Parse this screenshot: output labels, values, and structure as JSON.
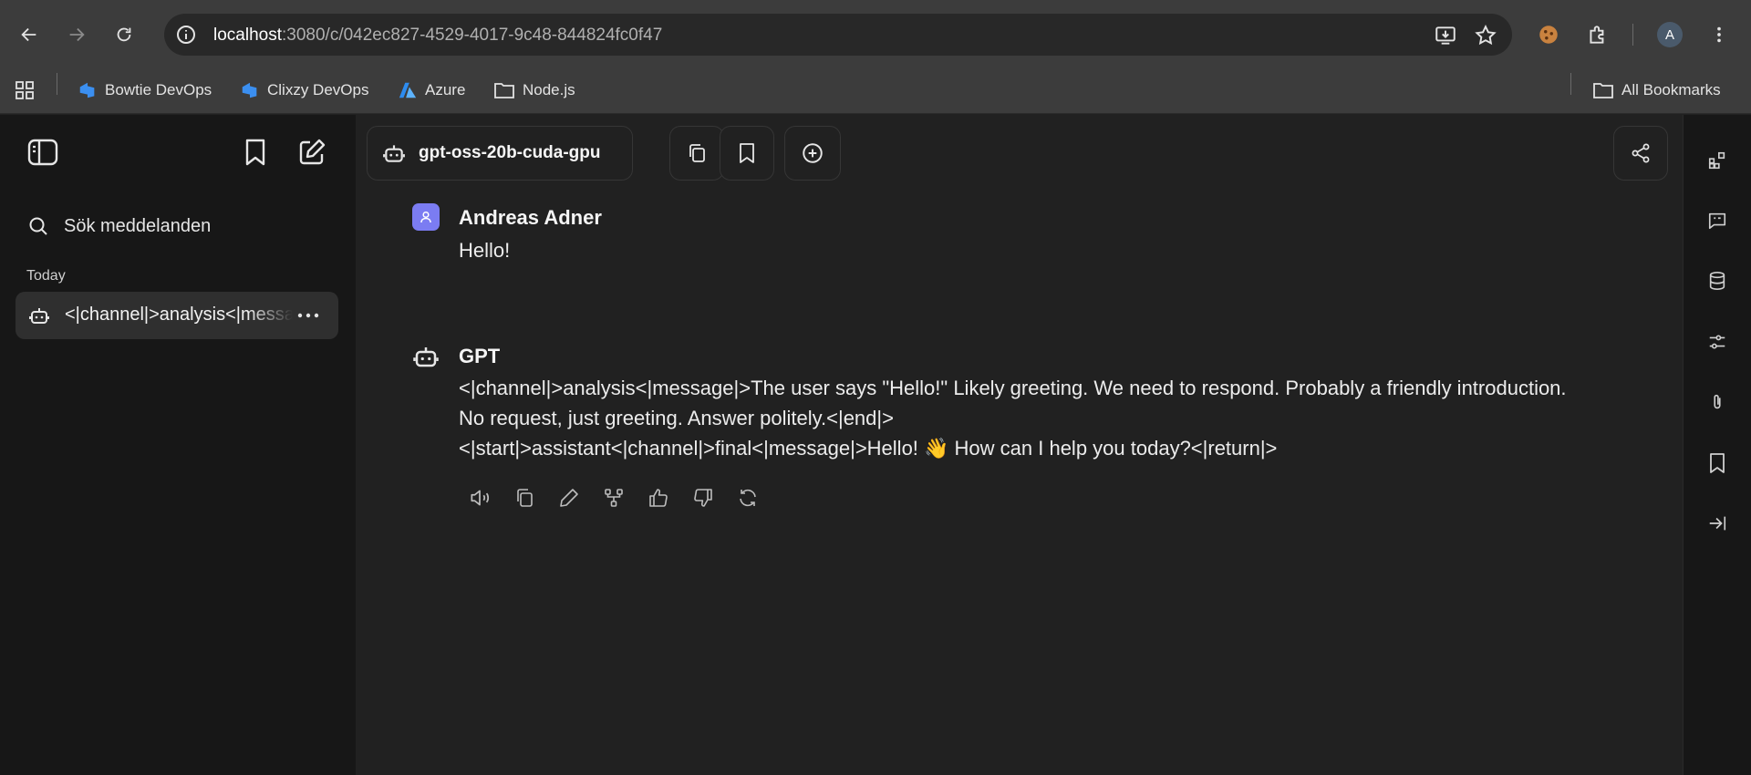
{
  "browser": {
    "url_host": "localhost",
    "url_path": ":3080/c/042ec827-4529-4017-9c48-844824fc0f47",
    "profile_initial": "A",
    "bookmarks": [
      "Bowtie DevOps",
      "Clixzy DevOps",
      "Azure",
      "Node.js"
    ],
    "all_bookmarks_label": "All Bookmarks"
  },
  "sidebar": {
    "search_placeholder": "Sök meddelanden",
    "section_today": "Today",
    "conversations": [
      {
        "title": "<|channel|>analysis<|message|>The user says \"Hello!\""
      }
    ]
  },
  "header": {
    "model_name": "gpt-oss-20b-cuda-gpu"
  },
  "messages": [
    {
      "sender": "Andreas Adner",
      "text": "Hello!"
    },
    {
      "sender": "GPT",
      "lines": [
        "<|channel|>analysis<|message|>The user says \"Hello!\" Likely greeting. We need to respond. Probably a friendly introduction. No request, just greeting. Answer politely.<|end|>",
        "<|start|>assistant<|channel|>final<|message|>Hello! 👋 How can I help you today?<|return|>"
      ]
    }
  ],
  "colors": {
    "accent_avatar": "#7b7cf2",
    "sidebar_bg": "#171717",
    "main_bg": "#212121",
    "browser_bg": "#3c3c3c"
  }
}
